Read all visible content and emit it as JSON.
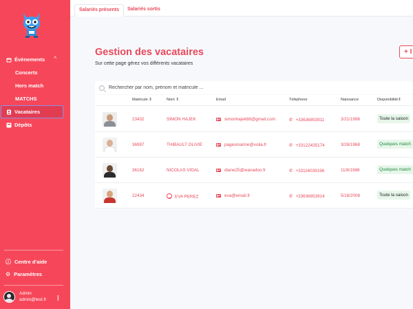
{
  "sidebar": {
    "nav": [
      {
        "label": "Évènements",
        "icon": "calendar-icon"
      },
      {
        "label": "Concerts"
      },
      {
        "label": "Hors match"
      },
      {
        "label": "MATCHS"
      },
      {
        "label": "Vacataires",
        "icon": "badge-icon"
      },
      {
        "label": "Dépôts",
        "icon": "box-icon"
      }
    ],
    "help_label": "Centre d'aide",
    "settings_label": "Paramètres",
    "user": {
      "name": "Admin",
      "email": "admin@test.fr"
    }
  },
  "tabs": [
    {
      "label": "Salariés présents"
    },
    {
      "label": "Salariés sortis"
    }
  ],
  "page": {
    "title": "Gestion des vacataires",
    "subtitle": "Sur cette page gérez vos différents vacataires",
    "add_label": "+ I"
  },
  "search": {
    "placeholder": "Rechercher par nom, prénom et matricule ..."
  },
  "table": {
    "columns": {
      "matricule": "Matricule",
      "nom": "Nom",
      "email": "Email",
      "telephone": "Téléphone",
      "naissance": "Naissance",
      "disponibilite": "Disponibilité"
    },
    "rows": [
      {
        "matricule": "23432",
        "nom": "SIMON HAJEK",
        "email": "simonhajek88@gmail.com",
        "telephone": "+33636853911",
        "naissance": "3/21/1996",
        "disponibilite": "Toute la saison"
      },
      {
        "matricule": "36997",
        "nom": "THIBAULT OLIVIE",
        "email": "pagesmarine@voila.fr",
        "telephone": "+33122435174",
        "naissance": "3/28/1968",
        "disponibilite": "Quelques match"
      },
      {
        "matricule": "36162",
        "nom": "NICOLAS VIDAL",
        "email": "diane25@wanadoo.fr",
        "telephone": "+33116039196",
        "naissance": "11/8/1988",
        "disponibilite": "Quelques match"
      },
      {
        "matricule": "22434",
        "nom": "EVA PEREZ",
        "email": "eva@email.fr",
        "telephone": "+33636853914",
        "naissance": "5/18/2008",
        "disponibilite": "Toute la saison"
      }
    ]
  },
  "colors": {
    "brand": "#f6475a",
    "accent": "#e8495b",
    "badge_bg": "#e7f6ea"
  }
}
